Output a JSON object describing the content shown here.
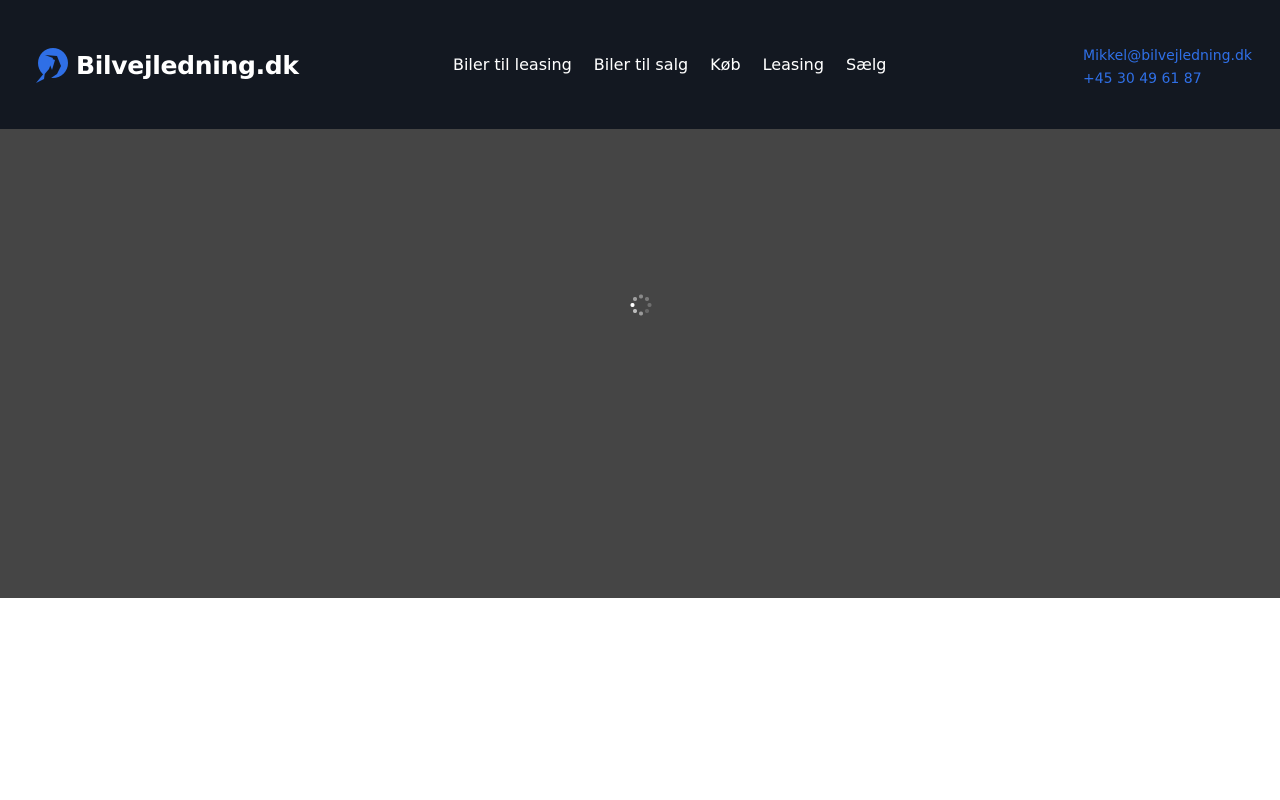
{
  "header": {
    "logo": {
      "text": "Bilvejledning.dk",
      "icon": "logo-mark-icon",
      "color": "#2f6fe6"
    },
    "nav": [
      {
        "label": "Biler til leasing"
      },
      {
        "label": "Biler til salg"
      },
      {
        "label": "Køb"
      },
      {
        "label": "Leasing"
      },
      {
        "label": "Sælg"
      }
    ],
    "contact": {
      "email": "Mikkel@bilvejledning.dk",
      "phone": "+45 30 49 61 87"
    }
  },
  "hero": {
    "state": "loading",
    "spinner_icon": "loading-spinner-icon"
  },
  "colors": {
    "header_bg": "#131821",
    "hero_bg": "#454545",
    "accent": "#2f6fe6",
    "nav_text": "#ffffff"
  }
}
